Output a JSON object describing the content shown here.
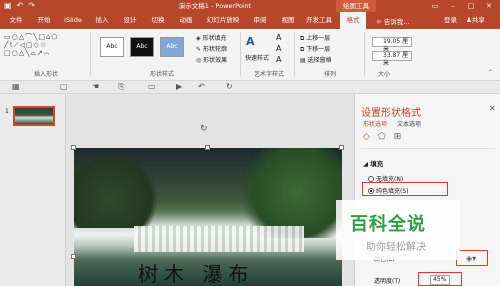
{
  "app": {
    "doc_title": "演示文稿1 - PowerPoint",
    "tool_tab": "绘图工具",
    "accent": "#b7472a"
  },
  "tabs": [
    "文件",
    "开始",
    "iSlide",
    "插入",
    "设计",
    "切换",
    "动画",
    "幻灯片放映",
    "审阅",
    "视图",
    "开发工具",
    "格式"
  ],
  "active_tab": "格式",
  "ribbon_right": {
    "search": "告诉我...",
    "login": "登录",
    "share": "共享"
  },
  "ribbon": {
    "groups": [
      "插入形状",
      "形状样式",
      "艺术字样式",
      "排列",
      "大小"
    ],
    "style_samples": [
      "Abc",
      "Abc",
      "Abc"
    ],
    "fill_commands": [
      "形状填充",
      "形状轮廓",
      "形状效果"
    ],
    "art_label": "快速样式",
    "arrange_commands": [
      "上移一层",
      "下移一层",
      "选择窗格"
    ],
    "size": {
      "height": "19.05 厘米",
      "width": "33.87 厘米"
    }
  },
  "slide": {
    "number": "1",
    "text": "树木 瀑布"
  },
  "format_pane": {
    "title": "设置形状格式",
    "tabs": [
      "形状选项",
      "文本选项"
    ],
    "section": "填充",
    "options": [
      "无填充(N)",
      "纯色填充(S)"
    ],
    "color_label": "颜色(C)",
    "transparency_label": "透明度(T)",
    "transparency_value": "45%"
  },
  "watermark": {
    "title": "百科全说",
    "subtitle": "助你轻松解决"
  }
}
